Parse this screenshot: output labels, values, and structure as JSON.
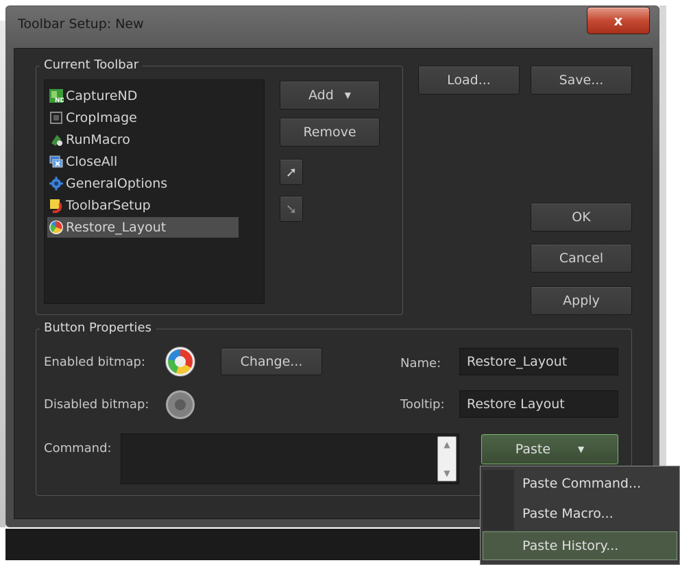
{
  "window": {
    "title": "Toolbar Setup: New",
    "close_label": "x"
  },
  "current_toolbar": {
    "legend": "Current Toolbar",
    "items": [
      {
        "label": "CaptureND",
        "icon": "capture-nd-icon"
      },
      {
        "label": "CropImage",
        "icon": "crop-image-icon"
      },
      {
        "label": "RunMacro",
        "icon": "run-macro-icon"
      },
      {
        "label": "CloseAll",
        "icon": "close-all-icon"
      },
      {
        "label": "GeneralOptions",
        "icon": "gear-icon"
      },
      {
        "label": "ToolbarSetup",
        "icon": "toolbar-setup-icon"
      },
      {
        "label": "Restore_Layout",
        "icon": "restore-layout-icon",
        "selected": true
      }
    ],
    "add_label": "Add",
    "remove_label": "Remove",
    "move_up_glyph": "➚",
    "move_down_glyph": "➘"
  },
  "buttons": {
    "load": "Load...",
    "save": "Save...",
    "ok": "OK",
    "cancel": "Cancel",
    "apply": "Apply"
  },
  "button_properties": {
    "legend": "Button Properties",
    "enabled_bitmap_label": "Enabled bitmap:",
    "disabled_bitmap_label": "Disabled bitmap:",
    "change_label": "Change...",
    "name_label": "Name:",
    "name_value": "Restore_Layout",
    "tooltip_label": "Tooltip:",
    "tooltip_value": "Restore Layout",
    "command_label": "Command:",
    "command_value": ""
  },
  "paste": {
    "label": "Paste",
    "menu": [
      "Paste Command...",
      "Paste Macro...",
      "Paste History..."
    ],
    "highlighted_index": 2
  },
  "colors": {
    "client_bg": "#2c2c2c",
    "paste_accent": "#7ab86a"
  }
}
